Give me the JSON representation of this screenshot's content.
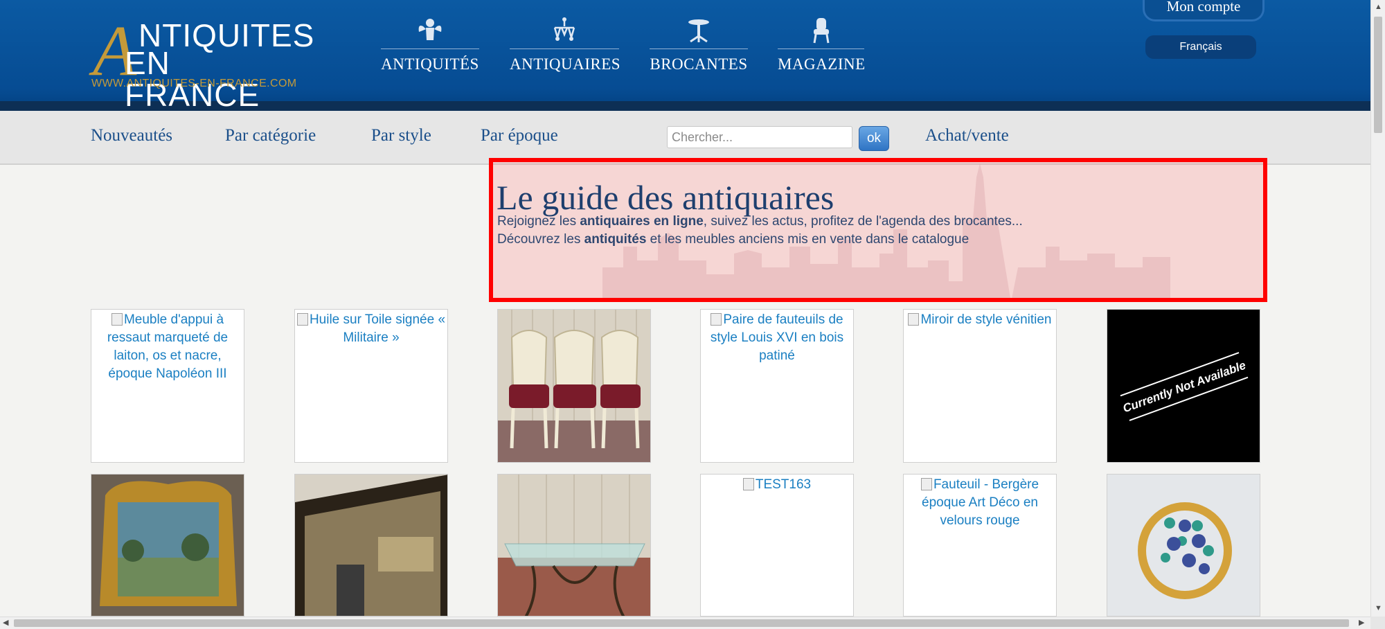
{
  "header": {
    "logo": {
      "letter": "A",
      "line1": "NTIQUITES",
      "line2": "EN FRANCE",
      "url": "WWW.ANTIQUITES-EN-FRANCE.COM"
    },
    "nav": [
      {
        "label": "ANTIQUITÉS",
        "icon": "cherub-icon"
      },
      {
        "label": "ANTIQUAIRES",
        "icon": "chandelier-icon"
      },
      {
        "label": "BROCANTES",
        "icon": "pedestal-table-icon"
      },
      {
        "label": "MAGAZINE",
        "icon": "armchair-icon"
      }
    ],
    "account_label": "Mon compte",
    "language_label": "Français"
  },
  "subnav": {
    "links": [
      "Nouveautés",
      "Par catégorie",
      "Par style",
      "Par époque"
    ],
    "search_placeholder": "Chercher...",
    "search_button": "ok",
    "achat_label": "Achat/vente"
  },
  "hero": {
    "title": "Le guide des antiquaires",
    "line1_pre": "Rejoignez les ",
    "line1_bold": "antiquaires en ligne",
    "line1_post": ", suivez les actus, profitez de l'agenda des brocantes...",
    "line2_pre": "Découvrez les ",
    "line2_bold": "antiquités",
    "line2_post": " et les meubles anciens mis en vente dans le catalogue"
  },
  "products": [
    {
      "alt": "Meuble d'appui à ressaut marqueté de laiton, os et nacre, époque Napoléon III",
      "image": "broken"
    },
    {
      "alt": "Huile sur Toile signée « Militaire »",
      "image": "broken"
    },
    {
      "alt": "",
      "image": "chairs-photo"
    },
    {
      "alt": "Paire de fauteuils de style Louis XVI en bois patiné",
      "image": "broken"
    },
    {
      "alt": "Miroir de style vénitien",
      "image": "broken"
    },
    {
      "alt": "",
      "image": "not-available",
      "overlay": "Currently Not Available"
    },
    {
      "alt": "",
      "image": "gilded-mirror-photo"
    },
    {
      "alt": "",
      "image": "mirror-photo"
    },
    {
      "alt": "",
      "image": "glass-table-photo"
    },
    {
      "alt": "TEST163",
      "image": "broken"
    },
    {
      "alt": "Fauteuil - Bergère époque Art Déco en velours rouge",
      "image": "broken"
    },
    {
      "alt": "",
      "image": "ring-photo"
    }
  ],
  "colors": {
    "header_blue": "#064c93",
    "accent_gold": "#c49a3a",
    "link_blue": "#1b4f8a",
    "highlight_red": "#ff0000"
  }
}
